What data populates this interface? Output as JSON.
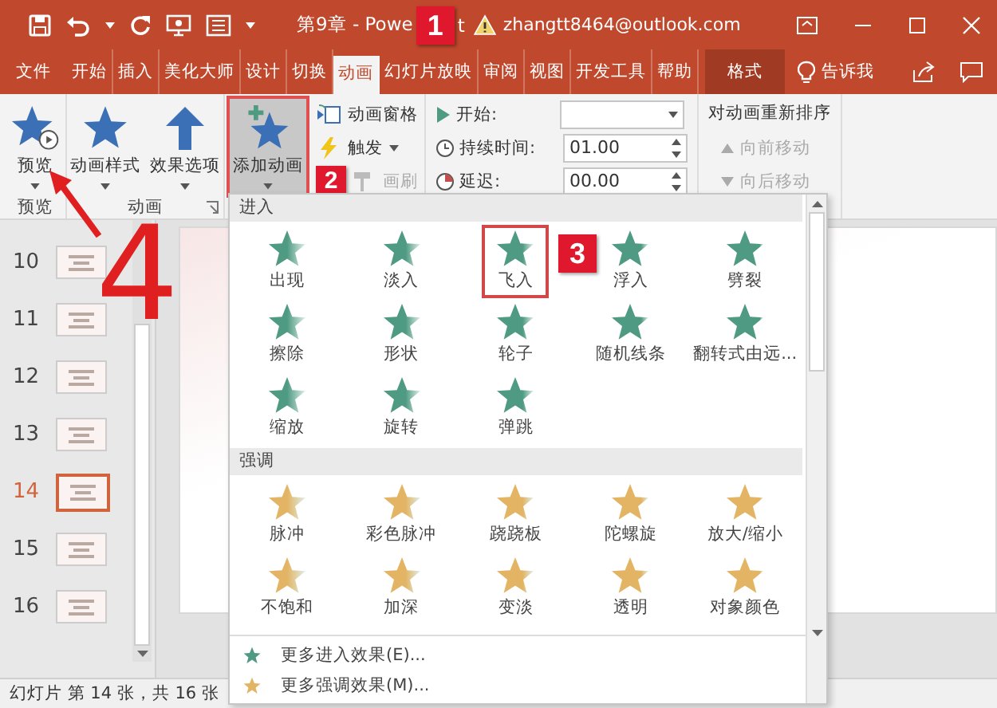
{
  "window": {
    "title": "第9章 - Powe",
    "title_tail": "t",
    "account": "zhangtt8464@outlook.com",
    "account_warning": true
  },
  "tabs": [
    {
      "label": "文件",
      "selected": false,
      "kind": "file"
    },
    {
      "label": "开始",
      "selected": false,
      "kind": "normal"
    },
    {
      "label": "插入",
      "selected": false,
      "kind": "normal"
    },
    {
      "label": "美化大师",
      "selected": false,
      "kind": "normal"
    },
    {
      "label": "设计",
      "selected": false,
      "kind": "normal"
    },
    {
      "label": "切换",
      "selected": false,
      "kind": "normal"
    },
    {
      "label": "动画",
      "selected": true,
      "kind": "normal"
    },
    {
      "label": "幻灯片放映",
      "selected": false,
      "kind": "normal"
    },
    {
      "label": "审阅",
      "selected": false,
      "kind": "normal"
    },
    {
      "label": "视图",
      "selected": false,
      "kind": "normal"
    },
    {
      "label": "开发工具",
      "selected": false,
      "kind": "normal"
    },
    {
      "label": "帮助",
      "selected": false,
      "kind": "normal"
    },
    {
      "label": "格式",
      "selected": false,
      "kind": "contextual"
    }
  ],
  "tell_me": "告诉我",
  "ribbon": {
    "preview": {
      "label": "预览",
      "group": "预览"
    },
    "animation_group": {
      "label": "动画",
      "buttons": [
        {
          "label": "动画样式",
          "kind": "star"
        },
        {
          "label": "效果选项",
          "kind": "arrow"
        }
      ]
    },
    "add_animation": {
      "label": "添加动画",
      "pressed": true
    },
    "small_buttons": [
      {
        "label": "动画窗格",
        "disabled": false,
        "dropdown": false,
        "kind": "pane"
      },
      {
        "label": "触发",
        "disabled": false,
        "dropdown": true,
        "kind": "trigger"
      },
      {
        "label": "画刷",
        "disabled": true,
        "dropdown": false,
        "kind": "painter"
      }
    ],
    "timing": [
      {
        "label": "开始:",
        "kind": "dropdown"
      },
      {
        "label": "持续时间:",
        "kind": "spinner",
        "value": "01.00"
      },
      {
        "label": "延迟:",
        "kind": "spinner",
        "value": "00.00"
      }
    ],
    "reorder": {
      "title": "对动画重新排序",
      "buttons": [
        {
          "label": "向前移动",
          "disabled": true,
          "kind": "up"
        },
        {
          "label": "向后移动",
          "disabled": true,
          "kind": "down"
        }
      ]
    }
  },
  "gallery": {
    "sections": [
      {
        "title": "进入",
        "kind": "entrance",
        "items": [
          {
            "label": "出现",
            "highlighted": false
          },
          {
            "label": "淡入",
            "highlighted": false
          },
          {
            "label": "飞入",
            "highlighted": true
          },
          {
            "label": "浮入",
            "highlighted": false
          },
          {
            "label": "劈裂",
            "highlighted": false
          },
          {
            "label": "擦除",
            "highlighted": false
          },
          {
            "label": "形状",
            "highlighted": false
          },
          {
            "label": "轮子",
            "highlighted": false
          },
          {
            "label": "随机线条",
            "highlighted": false
          },
          {
            "label": "翻转式由远...",
            "highlighted": false
          },
          {
            "label": "缩放",
            "highlighted": false
          },
          {
            "label": "旋转",
            "highlighted": false
          },
          {
            "label": "弹跳",
            "highlighted": false
          }
        ]
      },
      {
        "title": "强调",
        "kind": "emphasis",
        "items": [
          {
            "label": "脉冲",
            "highlighted": false
          },
          {
            "label": "彩色脉冲",
            "highlighted": false
          },
          {
            "label": "跷跷板",
            "highlighted": false
          },
          {
            "label": "陀螺旋",
            "highlighted": false
          },
          {
            "label": "放大/缩小",
            "highlighted": false
          },
          {
            "label": "不饱和",
            "highlighted": false
          },
          {
            "label": "加深",
            "highlighted": false
          },
          {
            "label": "变淡",
            "highlighted": false
          },
          {
            "label": "透明",
            "highlighted": false
          },
          {
            "label": "对象颜色",
            "highlighted": false
          }
        ]
      }
    ],
    "footer": [
      {
        "label": "更多进入效果(E)...",
        "kind": "entrance"
      },
      {
        "label": "更多强调效果(M)...",
        "kind": "emphasis"
      }
    ]
  },
  "slides": [
    {
      "number": "10",
      "selected": false
    },
    {
      "number": "11",
      "selected": false
    },
    {
      "number": "12",
      "selected": false
    },
    {
      "number": "13",
      "selected": false
    },
    {
      "number": "14",
      "selected": true
    },
    {
      "number": "15",
      "selected": false
    },
    {
      "number": "16",
      "selected": false
    }
  ],
  "status_bar": {
    "text": "幻灯片 第 14 张，共 16 张"
  },
  "annotations": [
    {
      "label": "1"
    },
    {
      "label": "2"
    },
    {
      "label": "3"
    },
    {
      "label": "4"
    }
  ]
}
